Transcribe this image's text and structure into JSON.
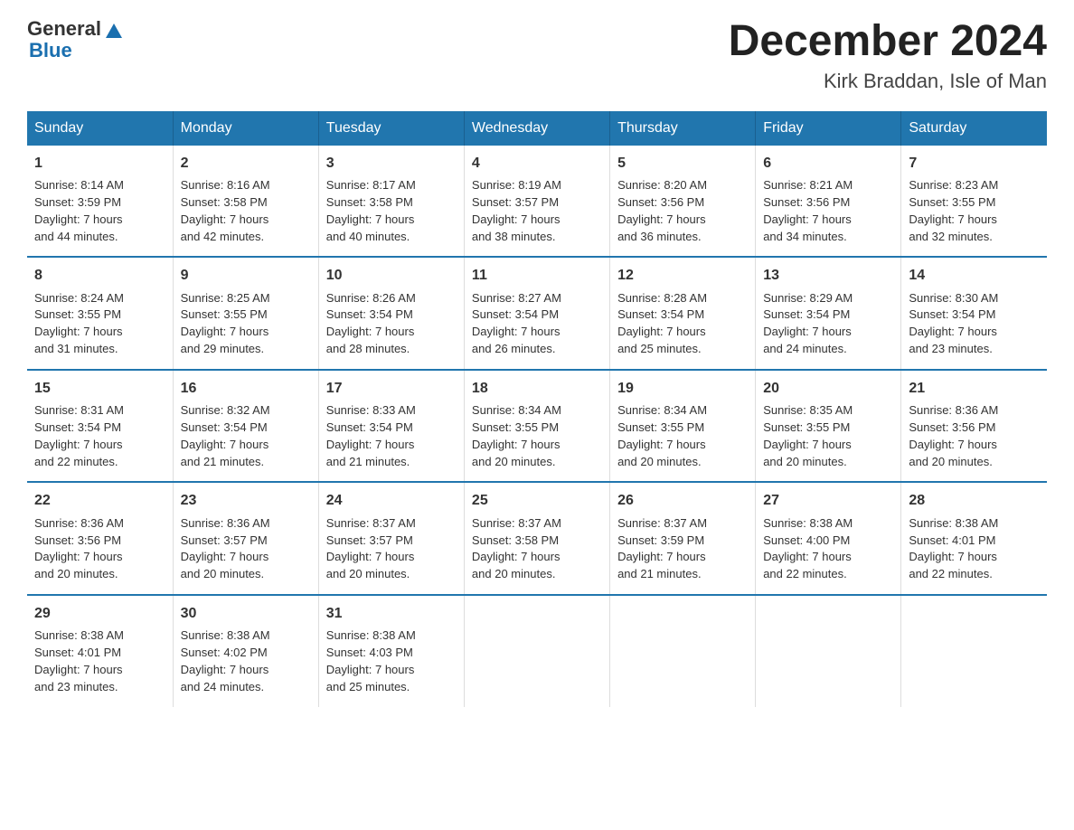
{
  "logo": {
    "text_general": "General",
    "text_blue": "Blue"
  },
  "title": "December 2024",
  "location": "Kirk Braddan, Isle of Man",
  "days_of_week": [
    "Sunday",
    "Monday",
    "Tuesday",
    "Wednesday",
    "Thursday",
    "Friday",
    "Saturday"
  ],
  "weeks": [
    [
      {
        "num": "1",
        "info": "Sunrise: 8:14 AM\nSunset: 3:59 PM\nDaylight: 7 hours\nand 44 minutes."
      },
      {
        "num": "2",
        "info": "Sunrise: 8:16 AM\nSunset: 3:58 PM\nDaylight: 7 hours\nand 42 minutes."
      },
      {
        "num": "3",
        "info": "Sunrise: 8:17 AM\nSunset: 3:58 PM\nDaylight: 7 hours\nand 40 minutes."
      },
      {
        "num": "4",
        "info": "Sunrise: 8:19 AM\nSunset: 3:57 PM\nDaylight: 7 hours\nand 38 minutes."
      },
      {
        "num": "5",
        "info": "Sunrise: 8:20 AM\nSunset: 3:56 PM\nDaylight: 7 hours\nand 36 minutes."
      },
      {
        "num": "6",
        "info": "Sunrise: 8:21 AM\nSunset: 3:56 PM\nDaylight: 7 hours\nand 34 minutes."
      },
      {
        "num": "7",
        "info": "Sunrise: 8:23 AM\nSunset: 3:55 PM\nDaylight: 7 hours\nand 32 minutes."
      }
    ],
    [
      {
        "num": "8",
        "info": "Sunrise: 8:24 AM\nSunset: 3:55 PM\nDaylight: 7 hours\nand 31 minutes."
      },
      {
        "num": "9",
        "info": "Sunrise: 8:25 AM\nSunset: 3:55 PM\nDaylight: 7 hours\nand 29 minutes."
      },
      {
        "num": "10",
        "info": "Sunrise: 8:26 AM\nSunset: 3:54 PM\nDaylight: 7 hours\nand 28 minutes."
      },
      {
        "num": "11",
        "info": "Sunrise: 8:27 AM\nSunset: 3:54 PM\nDaylight: 7 hours\nand 26 minutes."
      },
      {
        "num": "12",
        "info": "Sunrise: 8:28 AM\nSunset: 3:54 PM\nDaylight: 7 hours\nand 25 minutes."
      },
      {
        "num": "13",
        "info": "Sunrise: 8:29 AM\nSunset: 3:54 PM\nDaylight: 7 hours\nand 24 minutes."
      },
      {
        "num": "14",
        "info": "Sunrise: 8:30 AM\nSunset: 3:54 PM\nDaylight: 7 hours\nand 23 minutes."
      }
    ],
    [
      {
        "num": "15",
        "info": "Sunrise: 8:31 AM\nSunset: 3:54 PM\nDaylight: 7 hours\nand 22 minutes."
      },
      {
        "num": "16",
        "info": "Sunrise: 8:32 AM\nSunset: 3:54 PM\nDaylight: 7 hours\nand 21 minutes."
      },
      {
        "num": "17",
        "info": "Sunrise: 8:33 AM\nSunset: 3:54 PM\nDaylight: 7 hours\nand 21 minutes."
      },
      {
        "num": "18",
        "info": "Sunrise: 8:34 AM\nSunset: 3:55 PM\nDaylight: 7 hours\nand 20 minutes."
      },
      {
        "num": "19",
        "info": "Sunrise: 8:34 AM\nSunset: 3:55 PM\nDaylight: 7 hours\nand 20 minutes."
      },
      {
        "num": "20",
        "info": "Sunrise: 8:35 AM\nSunset: 3:55 PM\nDaylight: 7 hours\nand 20 minutes."
      },
      {
        "num": "21",
        "info": "Sunrise: 8:36 AM\nSunset: 3:56 PM\nDaylight: 7 hours\nand 20 minutes."
      }
    ],
    [
      {
        "num": "22",
        "info": "Sunrise: 8:36 AM\nSunset: 3:56 PM\nDaylight: 7 hours\nand 20 minutes."
      },
      {
        "num": "23",
        "info": "Sunrise: 8:36 AM\nSunset: 3:57 PM\nDaylight: 7 hours\nand 20 minutes."
      },
      {
        "num": "24",
        "info": "Sunrise: 8:37 AM\nSunset: 3:57 PM\nDaylight: 7 hours\nand 20 minutes."
      },
      {
        "num": "25",
        "info": "Sunrise: 8:37 AM\nSunset: 3:58 PM\nDaylight: 7 hours\nand 20 minutes."
      },
      {
        "num": "26",
        "info": "Sunrise: 8:37 AM\nSunset: 3:59 PM\nDaylight: 7 hours\nand 21 minutes."
      },
      {
        "num": "27",
        "info": "Sunrise: 8:38 AM\nSunset: 4:00 PM\nDaylight: 7 hours\nand 22 minutes."
      },
      {
        "num": "28",
        "info": "Sunrise: 8:38 AM\nSunset: 4:01 PM\nDaylight: 7 hours\nand 22 minutes."
      }
    ],
    [
      {
        "num": "29",
        "info": "Sunrise: 8:38 AM\nSunset: 4:01 PM\nDaylight: 7 hours\nand 23 minutes."
      },
      {
        "num": "30",
        "info": "Sunrise: 8:38 AM\nSunset: 4:02 PM\nDaylight: 7 hours\nand 24 minutes."
      },
      {
        "num": "31",
        "info": "Sunrise: 8:38 AM\nSunset: 4:03 PM\nDaylight: 7 hours\nand 25 minutes."
      },
      {
        "num": "",
        "info": ""
      },
      {
        "num": "",
        "info": ""
      },
      {
        "num": "",
        "info": ""
      },
      {
        "num": "",
        "info": ""
      }
    ]
  ]
}
